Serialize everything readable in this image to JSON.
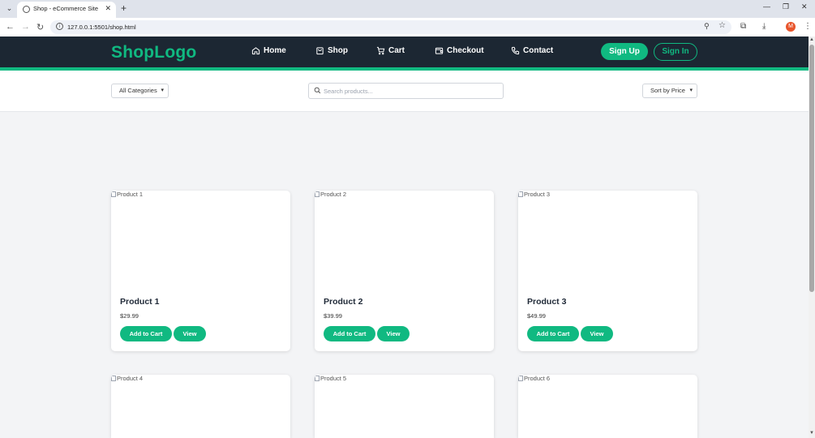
{
  "browser": {
    "tab_title": "Shop - eCommerce Site",
    "url": "127.0.0.1:5501/shop.html",
    "profile_initial": "M"
  },
  "header": {
    "logo": "ShopLogo",
    "nav": [
      {
        "label": "Home",
        "icon": "home-icon"
      },
      {
        "label": "Shop",
        "icon": "bag-icon"
      },
      {
        "label": "Cart",
        "icon": "cart-icon"
      },
      {
        "label": "Checkout",
        "icon": "wallet-icon"
      },
      {
        "label": "Contact",
        "icon": "phone-icon"
      }
    ],
    "signup_label": "Sign Up",
    "signin_label": "Sign In"
  },
  "filters": {
    "category": "All Categories",
    "search_placeholder": "Search products...",
    "sort": "Sort by Price"
  },
  "products": [
    {
      "img_alt": "Product 1",
      "name": "Product 1",
      "price": "$29.99"
    },
    {
      "img_alt": "Product 2",
      "name": "Product 2",
      "price": "$39.99"
    },
    {
      "img_alt": "Product 3",
      "name": "Product 3",
      "price": "$49.99"
    },
    {
      "img_alt": "Product 4"
    },
    {
      "img_alt": "Product 5"
    },
    {
      "img_alt": "Product 6"
    }
  ],
  "product_actions": {
    "add_label": "Add to Cart",
    "view_label": "View"
  },
  "colors": {
    "accent": "#10b981",
    "header_bg": "#1c2733"
  }
}
